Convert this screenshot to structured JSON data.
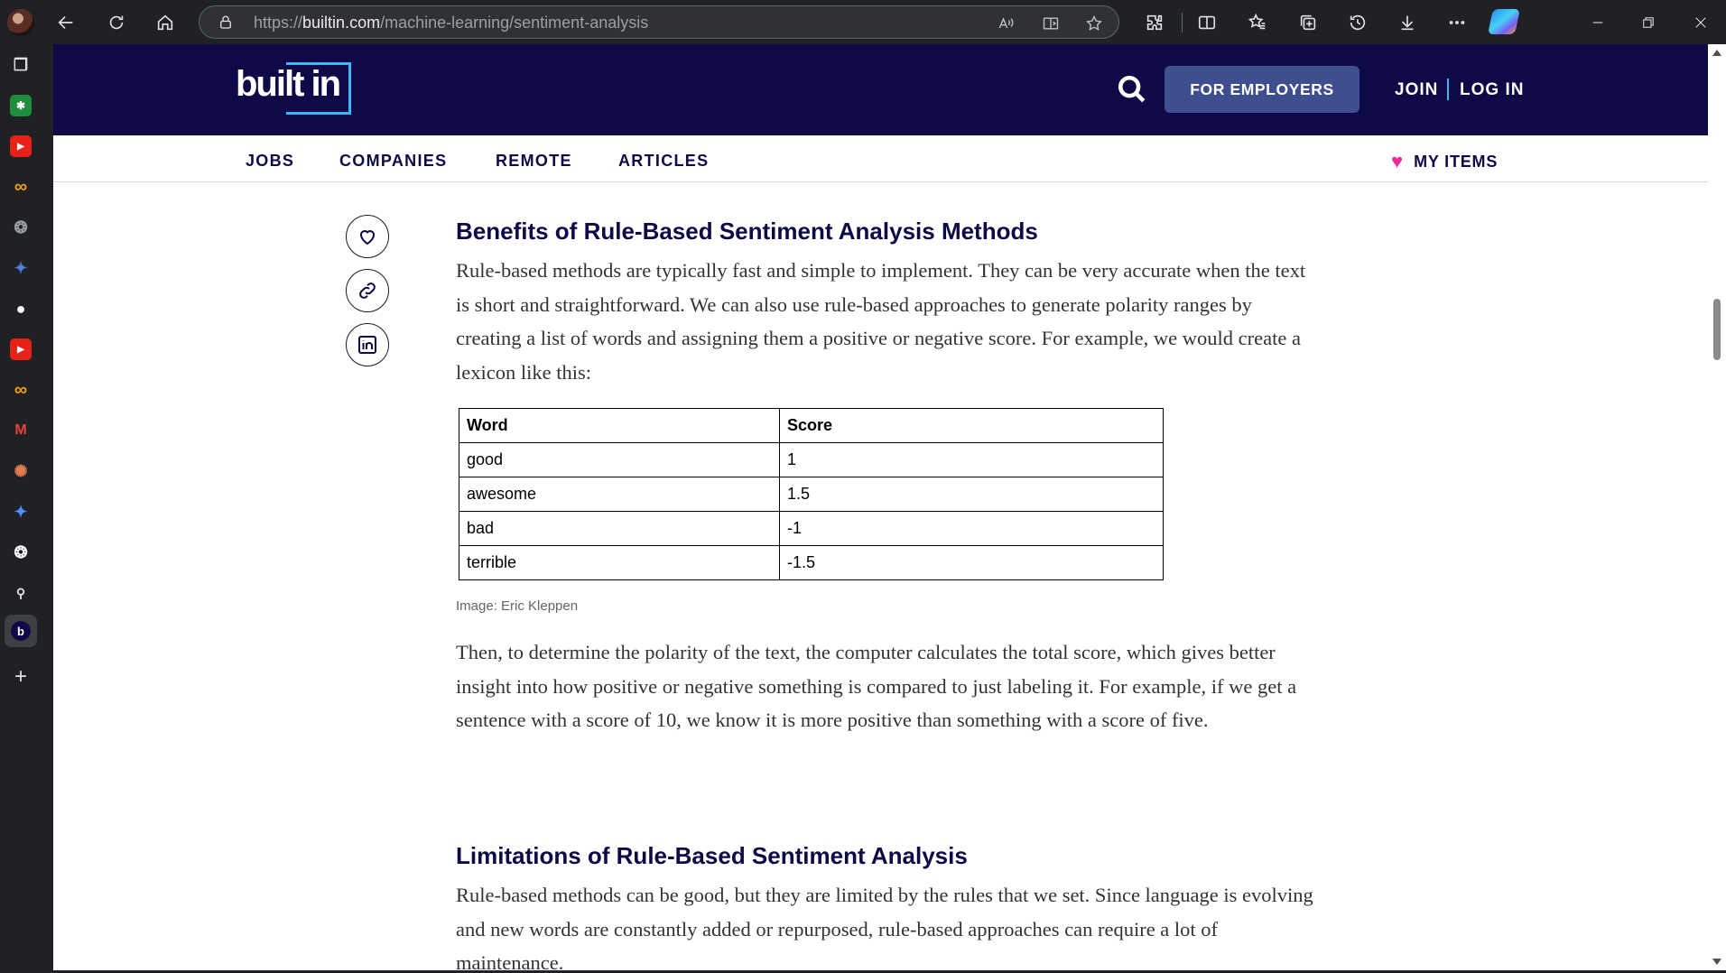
{
  "browser": {
    "url_domain": "builtin.com",
    "url_path": "/machine-learning/sentiment-analysis",
    "url_prefix": "https://"
  },
  "site": {
    "logo_text": "built in",
    "employers_button": "FOR EMPLOYERS",
    "join": "JOIN",
    "login": "LOG IN",
    "nav": [
      "JOBS",
      "COMPANIES",
      "REMOTE",
      "ARTICLES"
    ],
    "my_items": "MY ITEMS",
    "colors": {
      "header_bg": "#0d0a47",
      "accent_blue": "#3eb6f5",
      "heart": "#ec2a9c",
      "employers_btn": "#3f4e8f"
    }
  },
  "article": {
    "section1_title": "Benefits of Rule-Based Sentiment Analysis Methods",
    "section1_para": "Rule-based methods are typically fast and simple to implement. They can be very accurate when the text is short and straightforward. We can also use rule-based approaches to generate polarity ranges by creating a list of words and assigning them a positive or negative score. For example, we would create a lexicon like this:",
    "table": {
      "headers": [
        "Word",
        "Score"
      ],
      "rows": [
        [
          "good",
          "1"
        ],
        [
          "awesome",
          "1.5"
        ],
        [
          "bad",
          "-1"
        ],
        [
          "terrible",
          "-1.5"
        ]
      ]
    },
    "caption": "Image: Eric Kleppen",
    "section1_para2": "Then, to determine the polarity of the text, the computer calculates the total score, which gives better insight into how positive or negative something is compared to just labeling it. For example, if we get a sentence with a score of 10, we know it is more positive than something with a score of five.",
    "section2_title": "Limitations of Rule-Based Sentiment Analysis",
    "section2_para": "Rule-based methods can be good, but they are limited by the rules that we set. Since language is evolving and new words are constantly added or repurposed, rule-based approaches can require a lot of maintenance."
  },
  "icons": {
    "share": [
      "heart-icon",
      "link-icon",
      "linkedin-icon"
    ]
  }
}
